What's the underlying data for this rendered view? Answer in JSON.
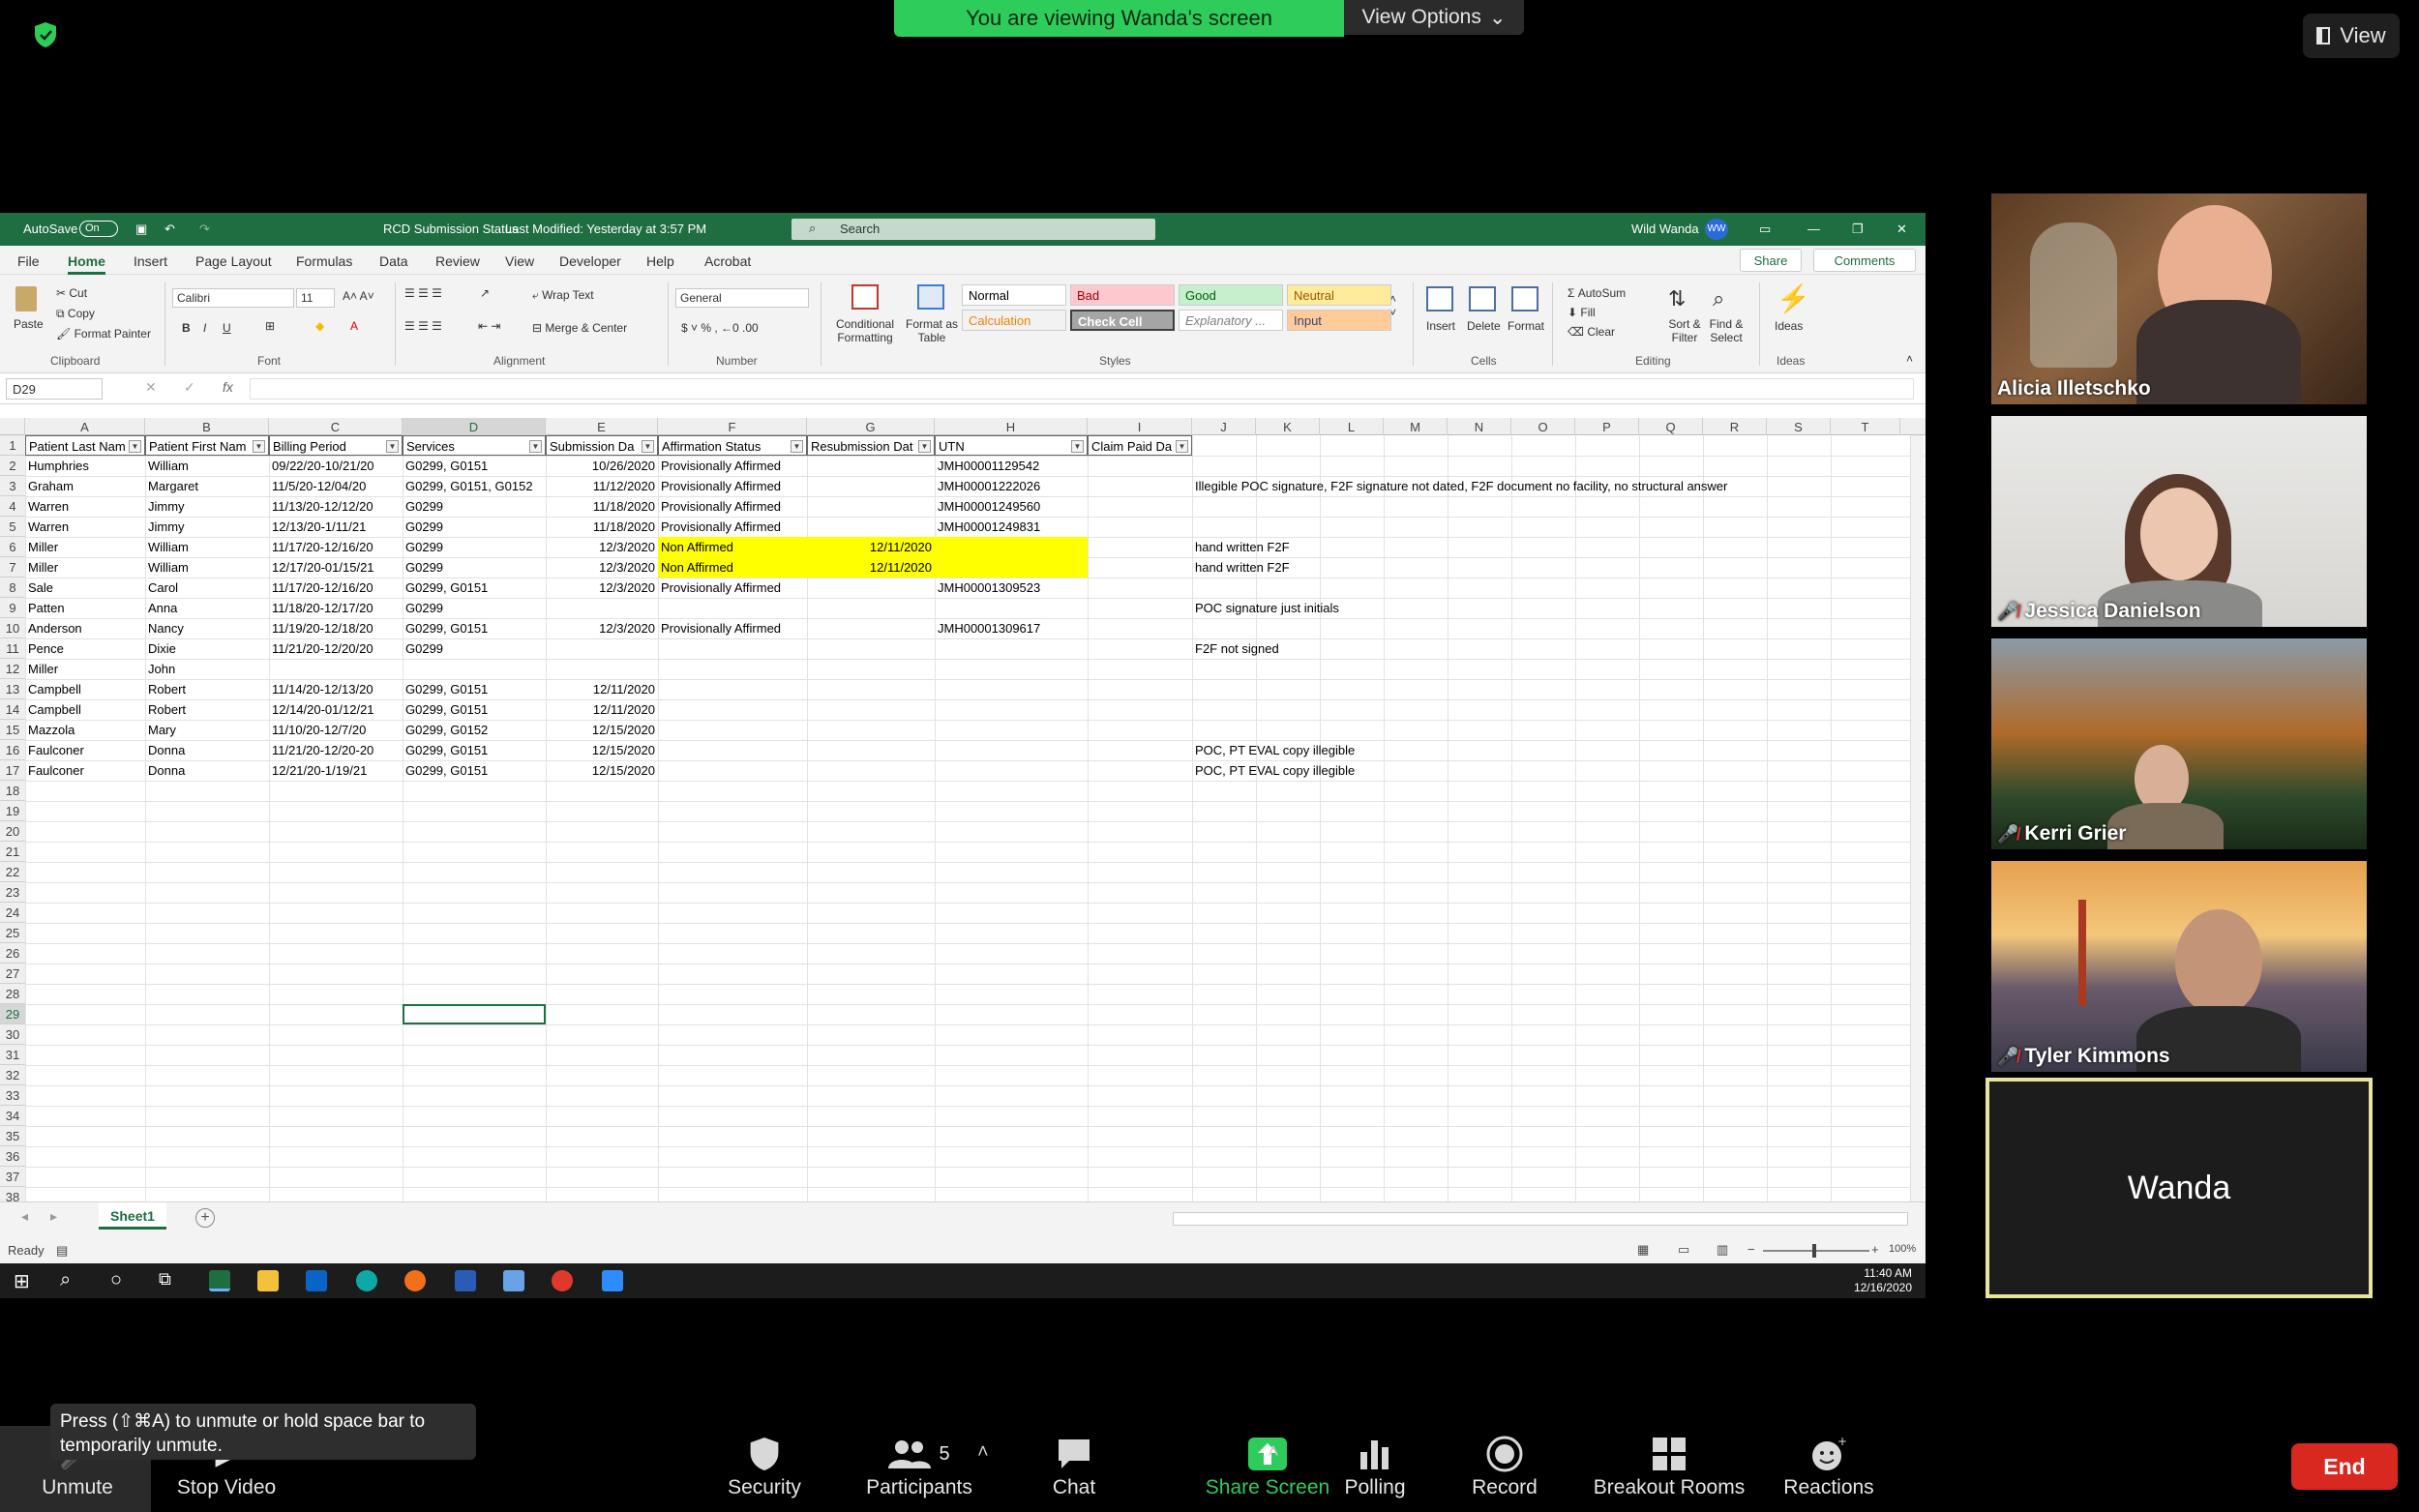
{
  "zoom": {
    "banner_text": "You are viewing Wanda's screen",
    "view_options_label": "View Options",
    "view_label": "View",
    "participants": [
      {
        "name": "Alicia Illetschko",
        "muted": false
      },
      {
        "name": "Jessica Danielson",
        "muted": true
      },
      {
        "name": "Kerri Grier",
        "muted": true
      },
      {
        "name": "Tyler Kimmons",
        "muted": true
      }
    ],
    "active_speaker": "Wanda",
    "tooltip": "Press  (⇧⌘A) to unmute or hold space bar to temporarily unmute.",
    "controls": {
      "unmute": "Unmute",
      "stop_video": "Stop Video",
      "security": "Security",
      "participants": "Participants",
      "participants_count": "5",
      "chat": "Chat",
      "share_screen": "Share Screen",
      "polling": "Polling",
      "record": "Record",
      "breakout_rooms": "Breakout Rooms",
      "reactions": "Reactions",
      "end": "End"
    },
    "colors": {
      "banner": "#2ecc5a",
      "share": "#2ecc5a",
      "end": "#d9281f",
      "active_border": "#e8e4a0"
    }
  },
  "excel": {
    "autosave": "AutoSave",
    "autosave_state": "On",
    "doc_title": "RCD Submission Status",
    "last_modified": "Last Modified: Yesterday at 3:57 PM",
    "search_placeholder": "Search",
    "user_name": "Wild Wanda",
    "user_initials": "WW",
    "menu": [
      "File",
      "Home",
      "Insert",
      "Page Layout",
      "Formulas",
      "Data",
      "Review",
      "View",
      "Developer",
      "Help",
      "Acrobat"
    ],
    "share_label": "Share",
    "comments_label": "Comments",
    "ribbon": {
      "paste": "Paste",
      "cut": "Cut",
      "copy": "Copy",
      "format_painter": "Format Painter",
      "clipboard": "Clipboard",
      "font_name": "Calibri",
      "font_size": "11",
      "font": "Font",
      "wrap_text": "Wrap Text",
      "merge_center": "Merge & Center",
      "alignment": "Alignment",
      "number_format": "General",
      "number": "Number",
      "conditional_formatting": "Conditional Formatting",
      "format_as_table": "Format as Table",
      "styles_label": "Styles",
      "styles": [
        {
          "name": "Normal",
          "bg": "#ffffff",
          "fg": "#000000"
        },
        {
          "name": "Bad",
          "bg": "#ffc7ce",
          "fg": "#9c0006"
        },
        {
          "name": "Good",
          "bg": "#c6efce",
          "fg": "#006100"
        },
        {
          "name": "Neutral",
          "bg": "#ffeb9c",
          "fg": "#9c5700"
        },
        {
          "name": "Calculation",
          "bg": "#f2f2f2",
          "fg": "#fa7d00"
        },
        {
          "name": "Check Cell",
          "bg": "#a5a5a5",
          "fg": "#ffffff"
        },
        {
          "name": "Explanatory ...",
          "bg": "#ffffff",
          "fg": "#7f7f7f"
        },
        {
          "name": "Input",
          "bg": "#ffcc99",
          "fg": "#3f3f76"
        }
      ],
      "insert": "Insert",
      "delete": "Delete",
      "format": "Format",
      "cells": "Cells",
      "autosum": "AutoSum",
      "fill": "Fill",
      "clear": "Clear",
      "sort_filter": "Sort & Filter",
      "find_select": "Find & Select",
      "editing": "Editing",
      "ideas": "Ideas",
      "ideas_group": "Ideas"
    },
    "name_box": "D29",
    "fx": "fx",
    "columns": [
      "A",
      "B",
      "C",
      "D",
      "E",
      "F",
      "G",
      "H",
      "I",
      "J",
      "K",
      "L",
      "M",
      "N",
      "O",
      "P",
      "Q",
      "R",
      "S",
      "T"
    ],
    "headers": [
      "Patient Last Nam",
      "Patient First Nam",
      "Billing Period",
      "Services",
      "Submission Da",
      "Affirmation Status",
      "Resubmission Dat",
      "UTN",
      "Claim Paid Da"
    ],
    "rows": [
      {
        "A": "Humphries",
        "B": "William",
        "C": "09/22/20-10/21/20",
        "D": "G0299, G0151",
        "E": "10/26/2020",
        "F": "Provisionally Affirmed",
        "G": "",
        "H": "JMH00001129542",
        "J": ""
      },
      {
        "A": "Graham",
        "B": "Margaret",
        "C": "11/5/20-12/04/20",
        "D": "G0299, G0151, G0152",
        "E": "11/12/2020",
        "F": "Provisionally Affirmed",
        "G": "",
        "H": "JMH00001222026",
        "J": "Illegible POC signature, F2F signature not dated, F2F document no facility, no structural answer"
      },
      {
        "A": "Warren",
        "B": "Jimmy",
        "C": "11/13/20-12/12/20",
        "D": "G0299",
        "E": "11/18/2020",
        "F": "Provisionally Affirmed",
        "G": "",
        "H": "JMH00001249560",
        "J": ""
      },
      {
        "A": "Warren",
        "B": "Jimmy",
        "C": "12/13/20-1/11/21",
        "D": "G0299",
        "E": "11/18/2020",
        "F": "Provisionally Affirmed",
        "G": "",
        "H": "JMH00001249831",
        "J": ""
      },
      {
        "A": "Miller",
        "B": "William",
        "C": "11/17/20-12/16/20",
        "D": "G0299",
        "E": "12/3/2020",
        "F": "Non Affirmed",
        "G": "12/11/2020",
        "H": "",
        "J": "hand written F2F",
        "hl": true
      },
      {
        "A": "Miller",
        "B": "William",
        "C": "12/17/20-01/15/21",
        "D": "G0299",
        "E": "12/3/2020",
        "F": "Non Affirmed",
        "G": "12/11/2020",
        "H": "",
        "J": "hand written F2F",
        "hl": true
      },
      {
        "A": "Sale",
        "B": "Carol",
        "C": "11/17/20-12/16/20",
        "D": "G0299, G0151",
        "E": "12/3/2020",
        "F": "Provisionally Affirmed",
        "G": "",
        "H": "JMH00001309523",
        "J": ""
      },
      {
        "A": "Patten",
        "B": "Anna",
        "C": "11/18/20-12/17/20",
        "D": "G0299",
        "E": "",
        "F": "",
        "G": "",
        "H": "",
        "J": "POC signature just initials"
      },
      {
        "A": "Anderson",
        "B": "Nancy",
        "C": "11/19/20-12/18/20",
        "D": "G0299, G0151",
        "E": "12/3/2020",
        "F": "Provisionally Affirmed",
        "G": "",
        "H": "JMH00001309617",
        "J": ""
      },
      {
        "A": "Pence",
        "B": "Dixie",
        "C": "11/21/20-12/20/20",
        "D": "G0299",
        "E": "",
        "F": "",
        "G": "",
        "H": "",
        "J": "F2F not signed"
      },
      {
        "A": "Miller",
        "B": "John",
        "C": "",
        "D": "",
        "E": "",
        "F": "",
        "G": "",
        "H": "",
        "J": ""
      },
      {
        "A": "Campbell",
        "B": "Robert",
        "C": "11/14/20-12/13/20",
        "D": "G0299, G0151",
        "E": "12/11/2020",
        "F": "",
        "G": "",
        "H": "",
        "J": ""
      },
      {
        "A": "Campbell",
        "B": "Robert",
        "C": "12/14/20-01/12/21",
        "D": "G0299, G0151",
        "E": "12/11/2020",
        "F": "",
        "G": "",
        "H": "",
        "J": ""
      },
      {
        "A": "Mazzola",
        "B": "Mary",
        "C": "11/10/20-12/7/20",
        "D": "G0299, G0152",
        "E": "12/15/2020",
        "F": "",
        "G": "",
        "H": "",
        "J": ""
      },
      {
        "A": "Faulconer",
        "B": "Donna",
        "C": "11/21/20-12/20-20",
        "D": "G0299, G0151",
        "E": "12/15/2020",
        "F": "",
        "G": "",
        "H": "",
        "J": "POC, PT EVAL copy illegible"
      },
      {
        "A": "Faulconer",
        "B": "Donna",
        "C": "12/21/20-1/19/21",
        "D": "G0299, G0151",
        "E": "12/15/2020",
        "F": "",
        "G": "",
        "H": "",
        "J": "POC, PT EVAL copy illegible"
      }
    ],
    "total_rows": 38,
    "sheet_tab": "Sheet1",
    "status": "Ready",
    "zoom_level": "100%",
    "clock_time": "11:40 AM",
    "clock_date": "12/16/2020"
  }
}
